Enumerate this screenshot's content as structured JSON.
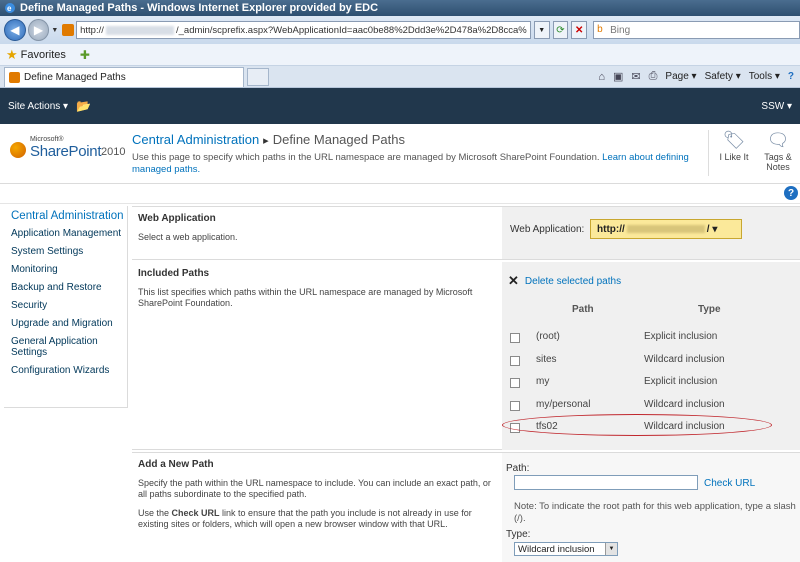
{
  "window": {
    "title": "Define Managed Paths - Windows Internet Explorer provided by EDC"
  },
  "browser": {
    "url_prefix": "http://",
    "url_suffix": "/_admin/scprefix.aspx?WebApplicationId=aac0be88%2Ddd3e%2D478a%2D8cca%",
    "search_placeholder": "Bing",
    "favorites_label": "Favorites",
    "tab_title": "Define Managed Paths",
    "cmd_page": "Page ▾",
    "cmd_safety": "Safety ▾",
    "cmd_tools": "Tools ▾"
  },
  "ribbon": {
    "site_actions": "Site Actions ▾",
    "user": "SSW ▾"
  },
  "header": {
    "logo_ms": "Microsoft®",
    "logo_sp": "SharePoint",
    "logo_year": "2010",
    "crumb_root": "Central Administration",
    "crumb_sep": "▸",
    "crumb_current": "Define Managed Paths",
    "description": "Use this page to specify which paths in the URL namespace are managed by Microsoft SharePoint Foundation.",
    "learn_more": "Learn about defining managed paths.",
    "i_like_it": "I Like It",
    "tags_notes": "Tags & Notes",
    "help": "?"
  },
  "quick_launch": {
    "heading": "Central Administration",
    "items": [
      "Application Management",
      "System Settings",
      "Monitoring",
      "Backup and Restore",
      "Security",
      "Upgrade and Migration",
      "General Application Settings",
      "Configuration Wizards"
    ]
  },
  "web_application": {
    "title": "Web Application",
    "text": "Select a web application.",
    "label": "Web Application:",
    "value_prefix": "http://",
    "value_suffix": "/ ▾"
  },
  "included_paths": {
    "title": "Included Paths",
    "text": "This list specifies which paths within the URL namespace are managed by Microsoft SharePoint Foundation.",
    "delete_label": "Delete selected paths",
    "col_path": "Path",
    "col_type": "Type",
    "rows": [
      {
        "path": "(root)",
        "type": "Explicit inclusion"
      },
      {
        "path": "sites",
        "type": "Wildcard inclusion"
      },
      {
        "path": "my",
        "type": "Explicit inclusion"
      },
      {
        "path": "my/personal",
        "type": "Wildcard inclusion"
      },
      {
        "path": "tfs02",
        "type": "Wildcard inclusion"
      }
    ]
  },
  "add_new_path": {
    "title": "Add a New Path",
    "text1": "Specify the path within the URL namespace to include. You can include an exact path, or all paths subordinate to the specified path.",
    "text2_pre": "Use the ",
    "text2_bold": "Check URL",
    "text2_post": " link to ensure that the path you include is not already in use for existing sites or folders, which will open a new browser window with that URL.",
    "path_label": "Path:",
    "path_value": "",
    "check_url": "Check URL",
    "note": "Note: To indicate the root path for this web application, type a slash (/).",
    "type_label": "Type:",
    "type_value": "Wildcard inclusion"
  }
}
